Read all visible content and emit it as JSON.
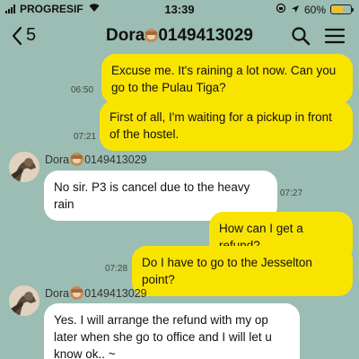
{
  "status_bar": {
    "carrier": "PROGRESIF",
    "time": "13:39",
    "battery_text": "60%",
    "battery_level": 0.6
  },
  "header": {
    "back_count": "5",
    "contact_name": "Dora",
    "contact_number": "0149413029"
  },
  "messages": [
    {
      "direction": "out",
      "text": "Excuse me. It's raining a lot now. Can you go to the Pulau Tiga?",
      "time": "06:50"
    },
    {
      "direction": "out",
      "text": "First of all, I'm waiting for a pickup in front of the hostel.",
      "time": "07:21"
    },
    {
      "direction": "in",
      "sender_name": "Dora",
      "sender_number": "0149413029",
      "text": "No sir. P3 is cancel due to the heavy rain",
      "time": "07:27"
    },
    {
      "direction": "out",
      "text": "How can I get a refund?",
      "time": ""
    },
    {
      "direction": "out",
      "text": "Do I have to go to the Jesselton point?",
      "time": "07:28"
    },
    {
      "direction": "in",
      "sender_name": "Dora",
      "sender_number": "0149413029",
      "text": "Yes. I will arrange the refund with my op later when she go to office and I will let u know ok.. ~",
      "time": ""
    }
  ],
  "icons": {
    "back": "chevron-left-icon",
    "search": "search-icon",
    "menu": "hamburger-menu-icon",
    "emoji": "see-no-evil-monkey-icon"
  },
  "colors": {
    "background": "#9bbdb3",
    "outgoing_bubble": "#f9e400",
    "incoming_bubble": "#ffffff",
    "battery": "#f2c21a"
  }
}
